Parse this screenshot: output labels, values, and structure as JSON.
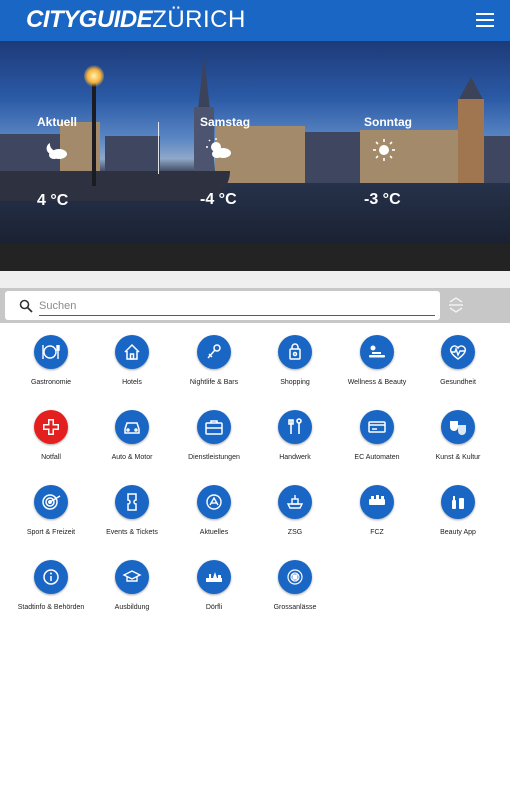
{
  "header": {
    "brand": "CITYGUIDE",
    "city": "ZÜRICH"
  },
  "weather": [
    {
      "day": "Aktuell",
      "temp": "4 °C",
      "icon": "partly-cloudy-night-icon"
    },
    {
      "day": "Samstag",
      "temp": "-4 °C",
      "icon": "sun-cloud-icon"
    },
    {
      "day": "Sonntag",
      "temp": "-3 °C",
      "icon": "sun-icon"
    }
  ],
  "search": {
    "placeholder": "Suchen"
  },
  "categories": [
    {
      "label": "Gastronomie",
      "icon": "cutlery-icon",
      "color": "#1a66c4"
    },
    {
      "label": "Hotels",
      "icon": "house-icon",
      "color": "#1a66c4"
    },
    {
      "label": "Nightlife & Bars",
      "icon": "microphone-icon",
      "color": "#1a66c4"
    },
    {
      "label": "Shopping",
      "icon": "shopping-bag-icon",
      "color": "#1a66c4"
    },
    {
      "label": "Wellness & Beauty",
      "icon": "massage-icon",
      "color": "#1a66c4"
    },
    {
      "label": "Gesundheit",
      "icon": "heart-pulse-icon",
      "color": "#1a66c4"
    },
    {
      "label": "Notfall",
      "icon": "cross-icon",
      "color": "#e3201f"
    },
    {
      "label": "Auto & Motor",
      "icon": "car-icon",
      "color": "#1a66c4"
    },
    {
      "label": "Dienstleistungen",
      "icon": "briefcase-icon",
      "color": "#1a66c4"
    },
    {
      "label": "Handwerk",
      "icon": "tools-icon",
      "color": "#1a66c4"
    },
    {
      "label": "EC Automaten",
      "icon": "card-icon",
      "color": "#1a66c4"
    },
    {
      "label": "Kunst & Kultur",
      "icon": "theater-masks-icon",
      "color": "#1a66c4"
    },
    {
      "label": "Sport & Freizeit",
      "icon": "target-icon",
      "color": "#1a66c4"
    },
    {
      "label": "Events & Tickets",
      "icon": "ticket-icon",
      "color": "#1a66c4"
    },
    {
      "label": "Aktuelles",
      "icon": "news-icon",
      "color": "#1a66c4"
    },
    {
      "label": "ZSG",
      "icon": "zsg-logo-icon",
      "color": "#1a66c4"
    },
    {
      "label": "FCZ",
      "icon": "fcz-logo-icon",
      "color": "#1a66c4"
    },
    {
      "label": "Beauty App",
      "icon": "cosmetics-icon",
      "color": "#1a66c4"
    },
    {
      "label": "Stadtinfo & Behörden",
      "icon": "info-icon",
      "color": "#1a66c4"
    },
    {
      "label": "Ausbildung",
      "icon": "graduation-icon",
      "color": "#1a66c4"
    },
    {
      "label": "Dörfli",
      "icon": "village-icon",
      "color": "#1a66c4"
    },
    {
      "label": "Grossanlässe",
      "icon": "crest-icon",
      "color": "#1a66c4"
    }
  ]
}
